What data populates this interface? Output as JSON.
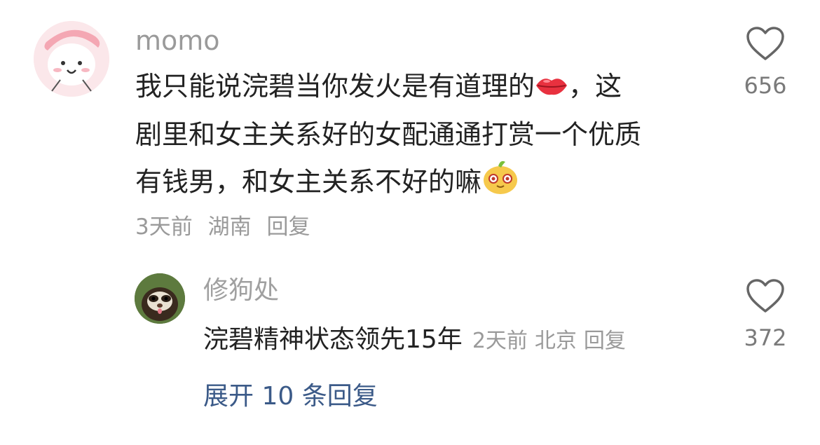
{
  "comment": {
    "username": "momo",
    "lines": [
      "我只能说浣碧当你发火是有道理的",
      "剧里和女主关系好的女配通通打赏一个优质",
      "有钱男，和女主关系不好的嘛"
    ],
    "line1_suffix": "，这",
    "emoji_1": "lips-emoji",
    "emoji_2": "smirk-emoji",
    "time": "3天前",
    "location": "湖南",
    "reply_label": "回复",
    "likes": "656"
  },
  "reply": {
    "username": "修狗处",
    "text": "浣碧精神状态领先15年",
    "time": "2天前",
    "location": "北京",
    "reply_label": "回复",
    "likes": "372"
  },
  "expand_label": "展开 10 条回复",
  "icons": {
    "like": "heart-outline-icon"
  },
  "colors": {
    "text_primary": "#222222",
    "text_secondary": "#9a9a9a",
    "link": "#3b5a88"
  }
}
